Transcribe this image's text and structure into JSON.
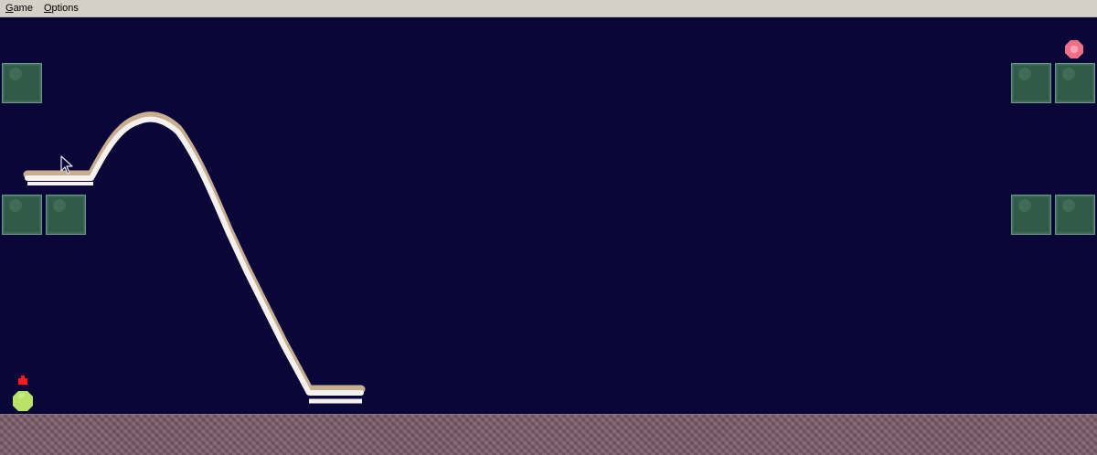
{
  "menubar": {
    "game": {
      "mnemonic": "G",
      "rest": "ame"
    },
    "options": {
      "mnemonic": "O",
      "rest": "ptions"
    }
  },
  "colors": {
    "background": "#0a0638",
    "block": "#2f5b48",
    "ground": "#7a5a68",
    "line_light": "#f4f1ee",
    "line_tan": "#c9ad8f",
    "goal": "#ef6f86",
    "player": "#b8e36a",
    "marker": "#ff1a1a"
  },
  "icons": {
    "goal": "pink-octagon-gem-icon",
    "player": "green-octagon-ball-icon",
    "marker": "red-marker-icon",
    "cursor": "mouse-pointer-icon"
  }
}
